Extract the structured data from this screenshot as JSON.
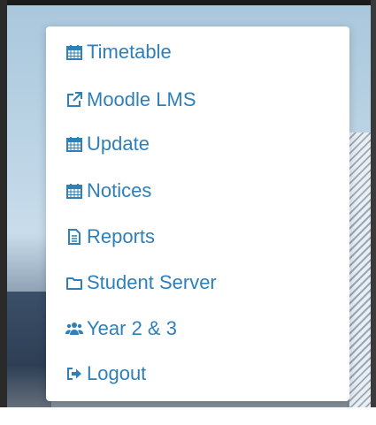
{
  "colors": {
    "link": "#2f7fb8",
    "menu_background": "#ffffff"
  },
  "menu": {
    "items": [
      {
        "label": "Timetable",
        "icon": "calendar-icon"
      },
      {
        "label": "Moodle LMS",
        "icon": "external-link-icon"
      },
      {
        "label": "Update",
        "icon": "calendar-icon"
      },
      {
        "label": "Notices",
        "icon": "calendar-icon"
      },
      {
        "label": "Reports",
        "icon": "document-icon"
      },
      {
        "label": "Student Server",
        "icon": "folder-icon"
      },
      {
        "label": "Year 2 & 3",
        "icon": "users-icon"
      },
      {
        "label": "Logout",
        "icon": "logout-icon"
      }
    ]
  }
}
